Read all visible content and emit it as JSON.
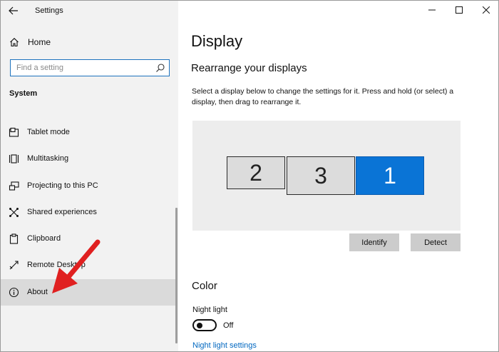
{
  "app": {
    "title": "Settings"
  },
  "sidebar": {
    "home_label": "Home",
    "search_placeholder": "Find a setting",
    "section_title": "System",
    "items": [
      {
        "label": "Tablet mode",
        "icon": "tablet-mode-icon"
      },
      {
        "label": "Multitasking",
        "icon": "multitasking-icon"
      },
      {
        "label": "Projecting to this PC",
        "icon": "projecting-icon"
      },
      {
        "label": "Shared experiences",
        "icon": "shared-experiences-icon"
      },
      {
        "label": "Clipboard",
        "icon": "clipboard-icon"
      },
      {
        "label": "Remote Desktop",
        "icon": "remote-desktop-icon"
      },
      {
        "label": "About",
        "icon": "info-icon",
        "selected": true
      }
    ]
  },
  "main": {
    "title": "Display",
    "rearrange_title": "Rearrange your displays",
    "rearrange_desc": "Select a display below to change the settings for it. Press and hold (or select) a display, then drag to rearrange it.",
    "monitors": [
      {
        "label": "2",
        "selected": false
      },
      {
        "label": "3",
        "selected": false
      },
      {
        "label": "1",
        "selected": true
      }
    ],
    "identify_label": "Identify",
    "detect_label": "Detect",
    "color_title": "Color",
    "night_light_label": "Night light",
    "night_light_state": "Off",
    "night_light_link": "Night light settings"
  },
  "colors": {
    "accent": "#0a74d6",
    "link": "#0067c0",
    "sidebar_bg": "#f2f2f2",
    "selected_bg": "#dadada",
    "annotation_arrow": "#e02020"
  }
}
